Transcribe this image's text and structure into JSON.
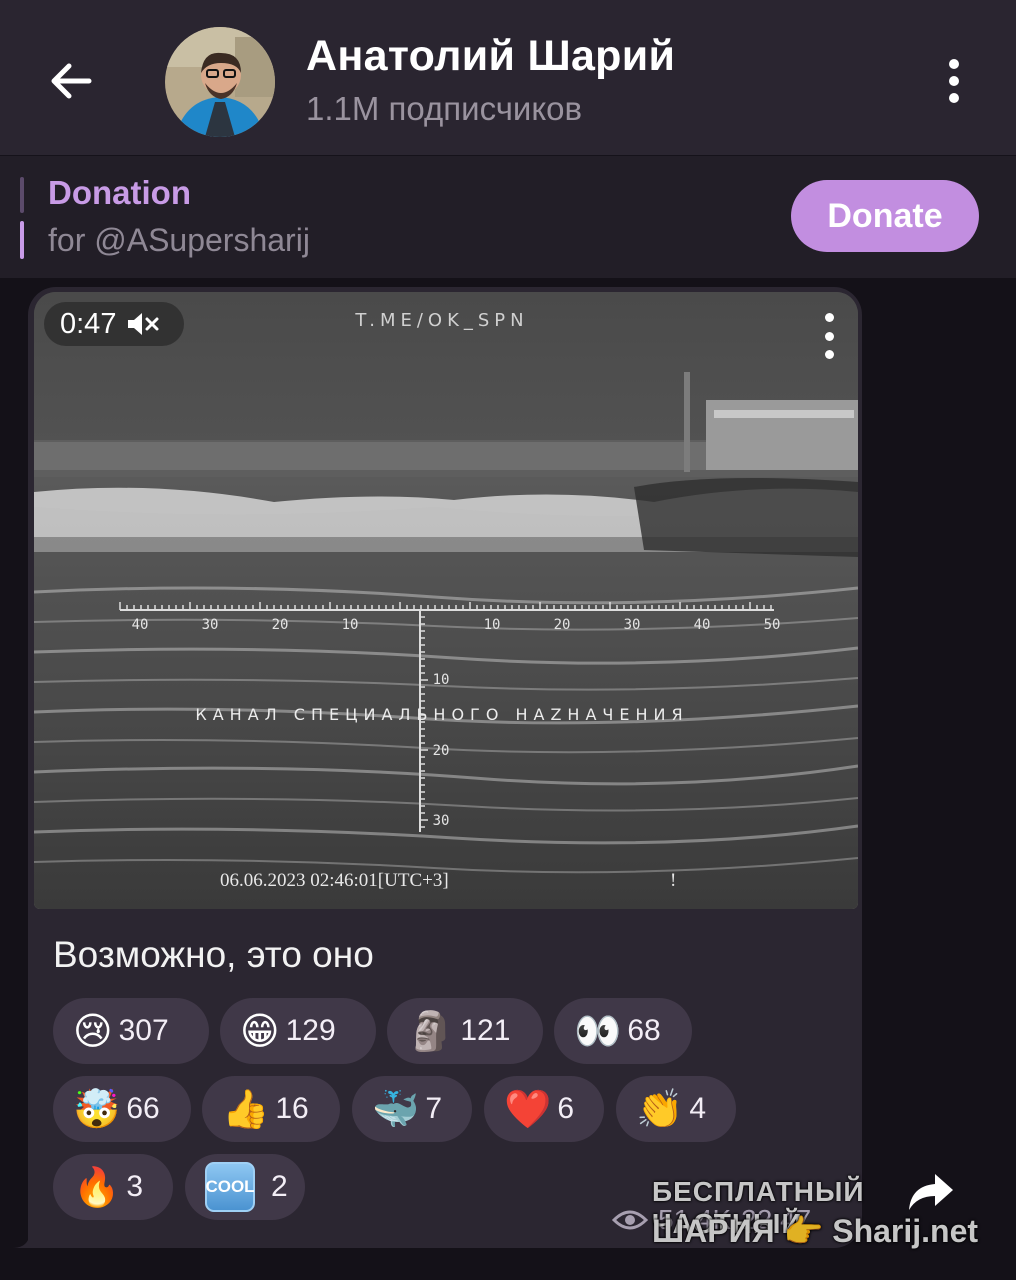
{
  "header": {
    "back_icon": "arrow-left-icon",
    "channel_name": "Анатолий Шарий",
    "subscribers": "1.1M подписчиков",
    "menu_icon": "more-vertical-icon"
  },
  "pinned": {
    "title": "Donation",
    "subtitle": "for @ASupersharij",
    "button_label": "Donate",
    "accent_color": "#c28ee0"
  },
  "message": {
    "video": {
      "duration": "0:47",
      "muted_icon": "speaker-muted-icon",
      "overlay_channel": "T.ME/OK_SPN",
      "overlay_text": "КАНАЛ СПЕЦИАЛЬНОГО НАZНАЧЕНИЯ",
      "timestamp": "06.06.2023  02:46:01[UTC+3]",
      "mark": "!",
      "scale_left": [
        "40",
        "30",
        "20",
        "10"
      ],
      "scale_right": [
        "10",
        "20",
        "30",
        "40",
        "50"
      ],
      "scale_down": [
        "10",
        "20",
        "30"
      ]
    },
    "caption": "Возможно, это оно",
    "reactions": [
      {
        "emoji": "😢",
        "count": "307"
      },
      {
        "emoji": "😁",
        "count": "129"
      },
      {
        "emoji": "🗿",
        "count": "121"
      },
      {
        "emoji": "👀",
        "count": "68"
      },
      {
        "emoji": "🤯",
        "count": "66"
      },
      {
        "emoji": "👍",
        "count": "16"
      },
      {
        "emoji": "🐳",
        "count": "7"
      },
      {
        "emoji": "❤️",
        "count": "6"
      },
      {
        "emoji": "👏",
        "count": "4"
      },
      {
        "emoji": "🔥",
        "count": "3"
      },
      {
        "emoji": "COOL",
        "count": "2"
      }
    ],
    "views": "51.4K",
    "time": "22:47"
  },
  "watermark": {
    "line1": "БЕСПЛАТНЫЙ ЧАСТНЫЙ",
    "line2": "ШАРИЯ 👉 Sharij.net"
  }
}
